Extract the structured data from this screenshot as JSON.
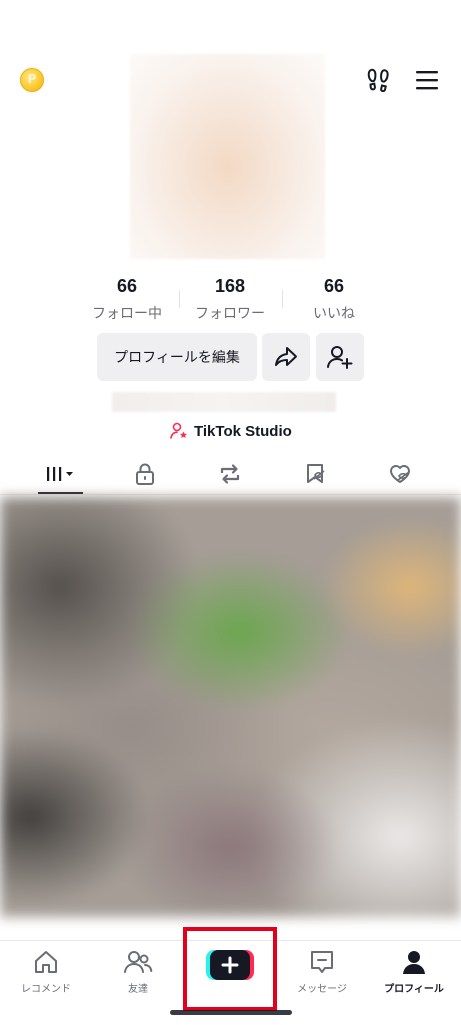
{
  "header": {
    "coin_icon": "coin-icon",
    "footprints_icon": "footprints-icon",
    "menu_icon": "hamburger-menu-icon",
    "coin_letter": "P"
  },
  "profile": {
    "stats": [
      {
        "value": "66",
        "label": "フォロー中"
      },
      {
        "value": "168",
        "label": "フォロワー"
      },
      {
        "value": "66",
        "label": "いいね"
      }
    ],
    "edit_profile_label": "プロフィールを編集",
    "studio_label": "TikTok Studio"
  },
  "tabs": [
    {
      "icon": "videos-grid-icon",
      "active": true
    },
    {
      "icon": "lock-icon"
    },
    {
      "icon": "repost-icon"
    },
    {
      "icon": "bookmark-hidden-icon"
    },
    {
      "icon": "liked-hidden-icon"
    }
  ],
  "bottom_nav": [
    {
      "label": "レコメンド",
      "icon": "home-icon"
    },
    {
      "label": "友達",
      "icon": "friends-icon"
    },
    {
      "label": "",
      "icon": "create-plus-icon"
    },
    {
      "label": "メッセージ",
      "icon": "inbox-icon"
    },
    {
      "label": "プロフィール",
      "icon": "profile-icon",
      "active": true
    }
  ],
  "colors": {
    "highlight": "#e3001b",
    "tiktok_cyan": "#25f4ee",
    "tiktok_pink": "#fe2c55",
    "text": "#161823"
  }
}
